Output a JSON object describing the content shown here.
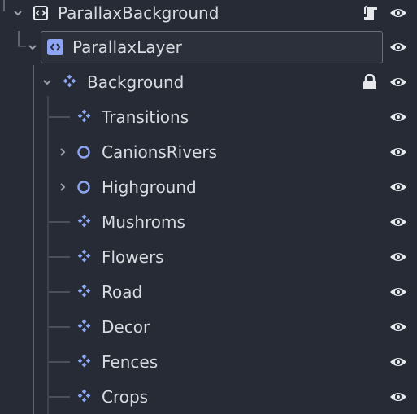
{
  "tree": {
    "root": {
      "label": "ParallaxBackground",
      "icon": "parallax-background-icon",
      "badge_icon": "script-icon",
      "visibility_icon": "eye-icon"
    },
    "layer": {
      "label": "ParallaxLayer",
      "icon": "parallax-layer-icon",
      "visibility_icon": "eye-icon"
    },
    "background": {
      "label": "Background",
      "icon": "tilemap-icon",
      "badge_icon": "lock-icon",
      "visibility_icon": "eye-icon"
    },
    "children": [
      {
        "label": "Transitions",
        "icon": "tilemap-icon",
        "expandable": false
      },
      {
        "label": "CanionsRivers",
        "icon": "node2d-icon",
        "expandable": true
      },
      {
        "label": "Highground",
        "icon": "node2d-icon",
        "expandable": true
      },
      {
        "label": "Mushroms",
        "icon": "tilemap-icon",
        "expandable": false
      },
      {
        "label": "Flowers",
        "icon": "tilemap-icon",
        "expandable": false
      },
      {
        "label": "Road",
        "icon": "tilemap-icon",
        "expandable": false
      },
      {
        "label": "Decor",
        "icon": "tilemap-icon",
        "expandable": false
      },
      {
        "label": "Fences",
        "icon": "tilemap-icon",
        "expandable": false
      },
      {
        "label": "Crops",
        "icon": "tilemap-icon",
        "expandable": false
      }
    ]
  },
  "colors": {
    "background": "#262b36",
    "node_icon_blue": "#8da5f3",
    "text": "#d9dbe0",
    "selection_border": "#6a6f7b"
  }
}
